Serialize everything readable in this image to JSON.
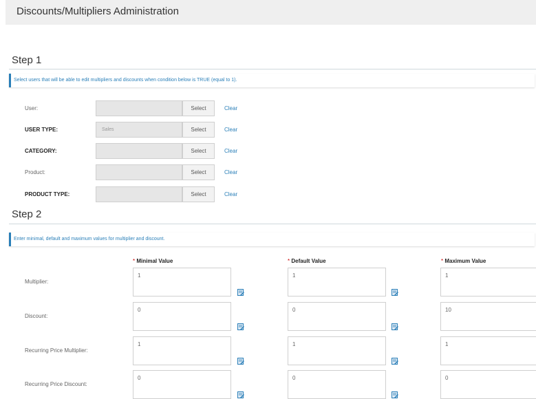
{
  "header": {
    "title": "Discounts/Multipliers Administration"
  },
  "step1": {
    "title": "Step 1",
    "info": "Select users that will be able to edit multipliers and discounts when condition below is TRUE (equal to 1).",
    "rows": [
      {
        "label": "User:",
        "value": "",
        "select": "Select",
        "clear": "Clear"
      },
      {
        "label": "USER TYPE:",
        "value": "Sales",
        "select": "Select",
        "clear": "Clear"
      },
      {
        "label": "CATEGORY:",
        "value": "",
        "select": "Select",
        "clear": "Clear"
      },
      {
        "label": "Product:",
        "value": "",
        "select": "Select",
        "clear": "Clear"
      },
      {
        "label": "PRODUCT TYPE:",
        "value": "",
        "select": "Select",
        "clear": "Clear"
      }
    ]
  },
  "step2": {
    "title": "Step 2",
    "info": "Enter minimal, default and maximum values for multiplier and discount.",
    "required_mark": "*",
    "columns": [
      "Minimal Value",
      "Default Value",
      "Maximum Value"
    ],
    "rows": [
      {
        "label": "Multiplier:",
        "values": [
          "1",
          "1",
          "1"
        ]
      },
      {
        "label": "Discount:",
        "values": [
          "0",
          "0",
          "10"
        ]
      },
      {
        "label": "Recurring Price Multiplier:",
        "values": [
          "1",
          "1",
          "1"
        ]
      },
      {
        "label": "Recurring Price Discount:",
        "values": [
          "0",
          "0",
          "0"
        ]
      }
    ],
    "edit_icon": "edit-icon"
  },
  "colors": {
    "accent": "#2a7fb8",
    "header_bg": "#efefef",
    "field_bg": "#e6e6e6"
  }
}
